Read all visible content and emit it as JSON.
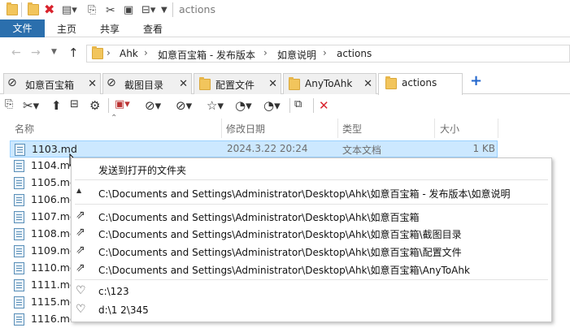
{
  "qat": {
    "title": "actions"
  },
  "ribbon": {
    "tabs": [
      "文件",
      "主页",
      "共享",
      "查看"
    ]
  },
  "address": {
    "crumbs": [
      "Ahk",
      "如意百宝箱 - 发布版本",
      "如意说明",
      "actions"
    ]
  },
  "tabs": [
    {
      "label": "如意百宝箱",
      "active": false
    },
    {
      "label": "截图目录",
      "active": false
    },
    {
      "label": "配置文件",
      "active": false
    },
    {
      "label": "AnyToAhk",
      "active": false
    },
    {
      "label": "actions",
      "active": true
    }
  ],
  "tabs_add": "+",
  "columns": [
    "名称",
    "修改日期",
    "类型",
    "大小"
  ],
  "files": [
    {
      "name": "1103.md",
      "date": "2024.3.22 20:24",
      "type": "文本文档",
      "size": "1 KB",
      "selected": true
    },
    {
      "name": "1104.md"
    },
    {
      "name": "1105.md"
    },
    {
      "name": "1106.md"
    },
    {
      "name": "1107.md"
    },
    {
      "name": "1108.md"
    },
    {
      "name": "1109.md"
    },
    {
      "name": "1110.md"
    },
    {
      "name": "1111.md"
    },
    {
      "name": "1115.md"
    },
    {
      "name": "1116.md"
    }
  ],
  "menu": {
    "header": "发送到打开的文件夹",
    "current": "C:\\Documents and Settings\\Administrator\\Desktop\\Ahk\\如意百宝箱 - 发布版本\\如意说明",
    "open_folders": [
      "C:\\Documents and Settings\\Administrator\\Desktop\\Ahk\\如意百宝箱",
      "C:\\Documents and Settings\\Administrator\\Desktop\\Ahk\\如意百宝箱\\截图目录",
      "C:\\Documents and Settings\\Administrator\\Desktop\\Ahk\\如意百宝箱\\配置文件",
      "C:\\Documents and Settings\\Administrator\\Desktop\\Ahk\\如意百宝箱\\AnyToAhk"
    ],
    "favorites": [
      "c:\\123",
      "d:\\1 2\\345"
    ]
  }
}
